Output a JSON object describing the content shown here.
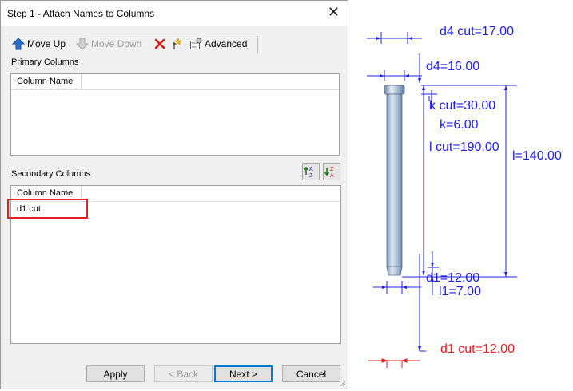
{
  "dialog": {
    "title": "Step 1 - Attach Names to Columns",
    "toolbar": {
      "move_up": "Move Up",
      "move_down": "Move Down",
      "advanced": "Advanced"
    },
    "primary": {
      "label": "Primary Columns",
      "column_header": "Column Name",
      "rows": []
    },
    "secondary": {
      "label": "Secondary Columns",
      "column_header": "Column Name",
      "rows": [
        "d1 cut"
      ]
    },
    "buttons": {
      "apply": "Apply",
      "back": "< Back",
      "next": "Next >",
      "cancel": "Cancel"
    }
  },
  "drawing": {
    "dim_color": "#2020e8",
    "highlight_color": "#e81e1e",
    "labels": {
      "d4_cut": "d4 cut=17.00",
      "d4": "d4=16.00",
      "k_cut": "k cut=30.00",
      "k": "k=6.00",
      "l_cut": "l cut=190.00",
      "l": "l=140.00",
      "d1": "d1=12.00",
      "l1": "l1=7.00",
      "d1_cut": "d1 cut=12.00"
    }
  }
}
